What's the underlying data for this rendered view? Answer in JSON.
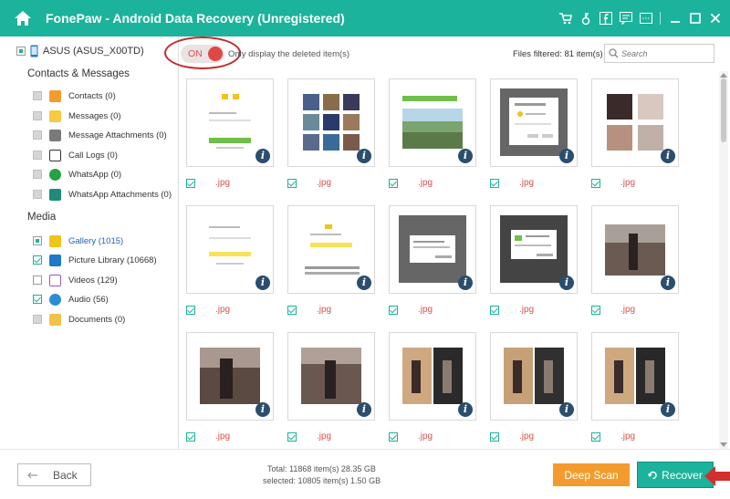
{
  "app": {
    "title": "FonePaw - Android Data Recovery (Unregistered)",
    "accent": "#1bb39b"
  },
  "titlebar_icons": [
    "cart-icon",
    "key-icon",
    "facebook-icon",
    "feedback-icon",
    "menu-icon",
    "minimize-icon",
    "maximize-icon",
    "close-icon"
  ],
  "device": {
    "name": "ASUS (ASUS_X00TD)"
  },
  "sidebar": {
    "contacts_header": "Contacts & Messages",
    "media_header": "Media",
    "contacts_items": [
      {
        "label": "Contacts (0)",
        "icon": "contacts-icon",
        "color": "#f39c2d"
      },
      {
        "label": "Messages (0)",
        "icon": "messages-icon",
        "color": "#f7c948"
      },
      {
        "label": "Message Attachments (0)",
        "icon": "attachment-icon",
        "color": "#7a7a7a"
      },
      {
        "label": "Call Logs (0)",
        "icon": "phone-icon",
        "color": "#ffffff"
      },
      {
        "label": "WhatsApp (0)",
        "icon": "whatsapp-icon",
        "color": "#25a244"
      },
      {
        "label": "WhatsApp Attachments (0)",
        "icon": "whatsapp-attachment-icon",
        "color": "#1f8a78"
      }
    ],
    "media_items": [
      {
        "label": "Gallery (1015)",
        "icon": "gallery-icon",
        "color": "#f0c419",
        "active": true
      },
      {
        "label": "Picture Library (10668)",
        "icon": "picture-library-icon",
        "color": "#1f78c8"
      },
      {
        "label": "Videos (129)",
        "icon": "video-icon",
        "color": "#9b59b6"
      },
      {
        "label": "Audio (56)",
        "icon": "audio-icon",
        "color": "#2d8cd6"
      },
      {
        "label": "Documents (0)",
        "icon": "folder-icon",
        "color": "#f3c14b"
      }
    ]
  },
  "toolbar": {
    "toggle_state": "ON",
    "toggle_label": "Only display the deleted item(s)",
    "files_filtered": "Files filtered: 81 item(s)",
    "search_placeholder": "Search"
  },
  "tiles": [
    {
      "caption": ".jpg"
    },
    {
      "caption": ".jpg"
    },
    {
      "caption": ".jpg"
    },
    {
      "caption": ".jpg"
    },
    {
      "caption": ".jpg"
    },
    {
      "caption": ".jpg"
    },
    {
      "caption": ".jpg"
    },
    {
      "caption": ".jpg"
    },
    {
      "caption": ".jpg"
    },
    {
      "caption": ".jpg"
    },
    {
      "caption": ".jpg"
    },
    {
      "caption": ".jpg"
    },
    {
      "caption": ".jpg"
    },
    {
      "caption": ".jpg"
    },
    {
      "caption": ".jpg"
    }
  ],
  "footer": {
    "back_label": "Back",
    "total": "Total: 11868 item(s) 28.35 GB",
    "selected": "selected: 10805 item(s) 1.50 GB",
    "deep_scan_label": "Deep Scan",
    "recover_label": "Recover"
  }
}
